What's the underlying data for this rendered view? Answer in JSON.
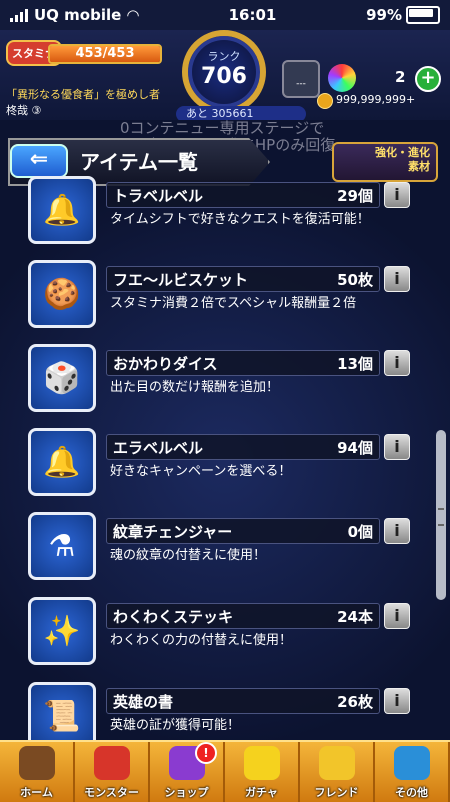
{
  "status_bar": {
    "carrier": "UQ mobile",
    "time": "16:01",
    "battery": "99%"
  },
  "hud": {
    "stamina_label": "スタミナ",
    "stamina_value": "453/453",
    "stamina_fraction": 1.0,
    "rank_label": "ランク",
    "rank_value": "706",
    "next_exp": "あと 305661",
    "lock_label": "---",
    "orb_count": "2",
    "title_line1": "「異形なる優食者」を極めし者",
    "title_line2": "柊哉 ③",
    "gold": "999,999,999+"
  },
  "background_text": {
    "line1": "0コンテニュー専用ステージで",
    "line2": "HPが0になった際にHPのみ回復"
  },
  "header": {
    "title": "アイテム一覧",
    "back_icon": "back-arrow-icon"
  },
  "evolve_button": {
    "line1": "強化・進化",
    "line2": "素材"
  },
  "items": [
    {
      "name": "トラベルベル",
      "count": "29個",
      "desc": "タイムシフトで好きなクエストを復活可能！",
      "icon": "🔔"
    },
    {
      "name": "フエ～ルビスケット",
      "count": "50枚",
      "desc": "スタミナ消費２倍でスペシャル報酬量２倍",
      "icon": "🍪"
    },
    {
      "name": "おかわりダイス",
      "count": "13個",
      "desc": "出た目の数だけ報酬を追加！",
      "icon": "🎲"
    },
    {
      "name": "エラベルベル",
      "count": "94個",
      "desc": "好きなキャンペーンを選べる！",
      "icon": "🔔"
    },
    {
      "name": "紋章チェンジャー",
      "count": "0個",
      "desc": "魂の紋章の付替えに使用！",
      "icon": "⚗"
    },
    {
      "name": "わくわくステッキ",
      "count": "24本",
      "desc": "わくわくの力の付替えに使用！",
      "icon": "✨"
    },
    {
      "name": "英雄の書",
      "count": "26枚",
      "desc": "英雄の証が獲得可能！",
      "icon": "📜"
    }
  ],
  "tabs": [
    {
      "label": "ホーム",
      "icon": "home-icon",
      "color": "#7a4a22"
    },
    {
      "label": "モンスター",
      "icon": "monster-icon",
      "color": "#d7352a"
    },
    {
      "label": "ショップ",
      "icon": "shop-orb-icon",
      "color": "#8a3bd0",
      "badge": "!"
    },
    {
      "label": "ガチャ",
      "icon": "gacha-icon",
      "color": "#f5d21e"
    },
    {
      "label": "フレンド",
      "icon": "friend-icon",
      "color": "#f2c52a"
    },
    {
      "label": "その他",
      "icon": "other-icon",
      "color": "#2a8fd8"
    }
  ]
}
